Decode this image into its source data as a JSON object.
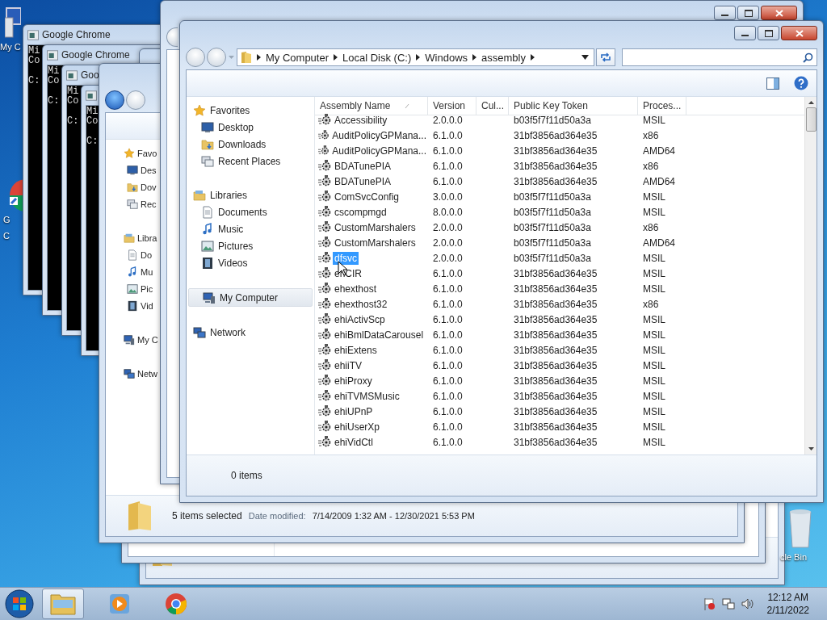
{
  "desktop_icons": [
    {
      "kind": "computer",
      "lines": [
        "My C"
      ]
    },
    {
      "kind": "chrome",
      "lines": [
        "G",
        "C"
      ]
    },
    {
      "kind": "recycle-bin",
      "lines": [
        "cle Bin"
      ]
    }
  ],
  "background_windows": [
    {
      "kind": "console",
      "title": "Google Chrome",
      "lines": [
        "Mi",
        "Co",
        "C:"
      ]
    },
    {
      "kind": "console",
      "title": "Google Chrome",
      "lines": [
        "Mi",
        "Co",
        "C:"
      ]
    },
    {
      "kind": "console",
      "title": "Goo",
      "lines": [
        "Mi",
        "Co",
        "C:"
      ]
    },
    {
      "kind": "console",
      "lines": [
        "Mi",
        "Co",
        "C:"
      ]
    },
    {
      "kind": "explorer"
    },
    {
      "kind": "explorer"
    },
    {
      "kind": "explorer",
      "nav_groups": [
        {
          "kind": "star",
          "label": "Favo",
          "children": [
            {
              "kind": "monitor",
              "label": "Des"
            },
            {
              "kind": "download-folder",
              "label": "Dov"
            },
            {
              "kind": "recent",
              "label": "Rec"
            }
          ]
        },
        {
          "kind": "library",
          "label": "Libra",
          "children": [
            {
              "kind": "document",
              "label": "Do"
            },
            {
              "kind": "music",
              "label": "Mu"
            },
            {
              "kind": "pictures",
              "label": "Pic"
            },
            {
              "kind": "videos",
              "label": "Vid"
            }
          ]
        },
        {
          "kind": "computer",
          "label": "My C"
        },
        {
          "kind": "network",
          "label": "Netw"
        }
      ],
      "status": {
        "selection": "5 items selected",
        "date_label": "Date modified:",
        "date_range": "7/14/2009 1:32 AM - 12/30/2021 5:53 PM"
      }
    },
    {
      "kind": "explorer"
    }
  ],
  "window": {
    "address": [
      "My Computer",
      "Local Disk (C:)",
      "Windows",
      "assembly"
    ],
    "sidebar": {
      "groups": [
        {
          "kind": "star",
          "label": "Favorites",
          "selected": false,
          "children": [
            {
              "kind": "monitor",
              "label": "Desktop",
              "selected": false
            },
            {
              "kind": "download-folder",
              "label": "Downloads",
              "selected": false
            },
            {
              "kind": "recent",
              "label": "Recent Places",
              "selected": false
            }
          ]
        },
        {
          "kind": "library",
          "label": "Libraries",
          "selected": false,
          "children": [
            {
              "kind": "document",
              "label": "Documents",
              "selected": false
            },
            {
              "kind": "music",
              "label": "Music",
              "selected": false
            },
            {
              "kind": "pictures",
              "label": "Pictures",
              "selected": false
            },
            {
              "kind": "videos",
              "label": "Videos",
              "selected": false
            }
          ]
        },
        {
          "kind": "computer",
          "label": "My Computer",
          "selected": true
        },
        {
          "kind": "network",
          "label": "Network",
          "selected": false
        }
      ]
    },
    "table": {
      "columns": [
        "Assembly Name",
        "Version",
        "Cul...",
        "Public Key Token",
        "Proces..."
      ],
      "rows": [
        {
          "name": "Accessibility",
          "version": "2.0.0.0",
          "token": "b03f5f7f11d50a3a",
          "arch": "MSIL",
          "selected": false
        },
        {
          "name": "AuditPolicyGPMana...",
          "version": "6.1.0.0",
          "token": "31bf3856ad364e35",
          "arch": "x86",
          "selected": false
        },
        {
          "name": "AuditPolicyGPMana...",
          "version": "6.1.0.0",
          "token": "31bf3856ad364e35",
          "arch": "AMD64",
          "selected": false
        },
        {
          "name": "BDATunePIA",
          "version": "6.1.0.0",
          "token": "31bf3856ad364e35",
          "arch": "x86",
          "selected": false
        },
        {
          "name": "BDATunePIA",
          "version": "6.1.0.0",
          "token": "31bf3856ad364e35",
          "arch": "AMD64",
          "selected": false
        },
        {
          "name": "ComSvcConfig",
          "version": "3.0.0.0",
          "token": "b03f5f7f11d50a3a",
          "arch": "MSIL",
          "selected": false
        },
        {
          "name": "cscompmgd",
          "version": "8.0.0.0",
          "token": "b03f5f7f11d50a3a",
          "arch": "MSIL",
          "selected": false
        },
        {
          "name": "CustomMarshalers",
          "version": "2.0.0.0",
          "token": "b03f5f7f11d50a3a",
          "arch": "x86",
          "selected": false
        },
        {
          "name": "CustomMarshalers",
          "version": "2.0.0.0",
          "token": "b03f5f7f11d50a3a",
          "arch": "AMD64",
          "selected": false
        },
        {
          "name": "dfsvc",
          "version": "2.0.0.0",
          "token": "b03f5f7f11d50a3a",
          "arch": "MSIL",
          "selected": true
        },
        {
          "name": "ehCIR",
          "version": "6.1.0.0",
          "token": "31bf3856ad364e35",
          "arch": "MSIL",
          "selected": false
        },
        {
          "name": "ehexthost",
          "version": "6.1.0.0",
          "token": "31bf3856ad364e35",
          "arch": "MSIL",
          "selected": false
        },
        {
          "name": "ehexthost32",
          "version": "6.1.0.0",
          "token": "31bf3856ad364e35",
          "arch": "x86",
          "selected": false
        },
        {
          "name": "ehiActivScp",
          "version": "6.1.0.0",
          "token": "31bf3856ad364e35",
          "arch": "MSIL",
          "selected": false
        },
        {
          "name": "ehiBmlDataCarousel",
          "version": "6.1.0.0",
          "token": "31bf3856ad364e35",
          "arch": "MSIL",
          "selected": false
        },
        {
          "name": "ehiExtens",
          "version": "6.1.0.0",
          "token": "31bf3856ad364e35",
          "arch": "MSIL",
          "selected": false
        },
        {
          "name": "ehiiTV",
          "version": "6.1.0.0",
          "token": "31bf3856ad364e35",
          "arch": "MSIL",
          "selected": false
        },
        {
          "name": "ehiProxy",
          "version": "6.1.0.0",
          "token": "31bf3856ad364e35",
          "arch": "MSIL",
          "selected": false
        },
        {
          "name": "ehiTVMSMusic",
          "version": "6.1.0.0",
          "token": "31bf3856ad364e35",
          "arch": "MSIL",
          "selected": false
        },
        {
          "name": "ehiUPnP",
          "version": "6.1.0.0",
          "token": "31bf3856ad364e35",
          "arch": "MSIL",
          "selected": false
        },
        {
          "name": "ehiUserXp",
          "version": "6.1.0.0",
          "token": "31bf3856ad364e35",
          "arch": "MSIL",
          "selected": false
        },
        {
          "name": "ehiVidCtl",
          "version": "6.1.0.0",
          "token": "31bf3856ad364e35",
          "arch": "MSIL",
          "selected": false
        }
      ]
    },
    "status_bar": "0 items"
  },
  "taskbar": {
    "items": [
      {
        "kind": "explorer",
        "selected": true
      },
      {
        "kind": "media-player",
        "selected": false
      },
      {
        "kind": "chrome",
        "selected": false
      }
    ],
    "tray": {
      "time": "12:12 AM",
      "date": "2/11/2022"
    }
  }
}
